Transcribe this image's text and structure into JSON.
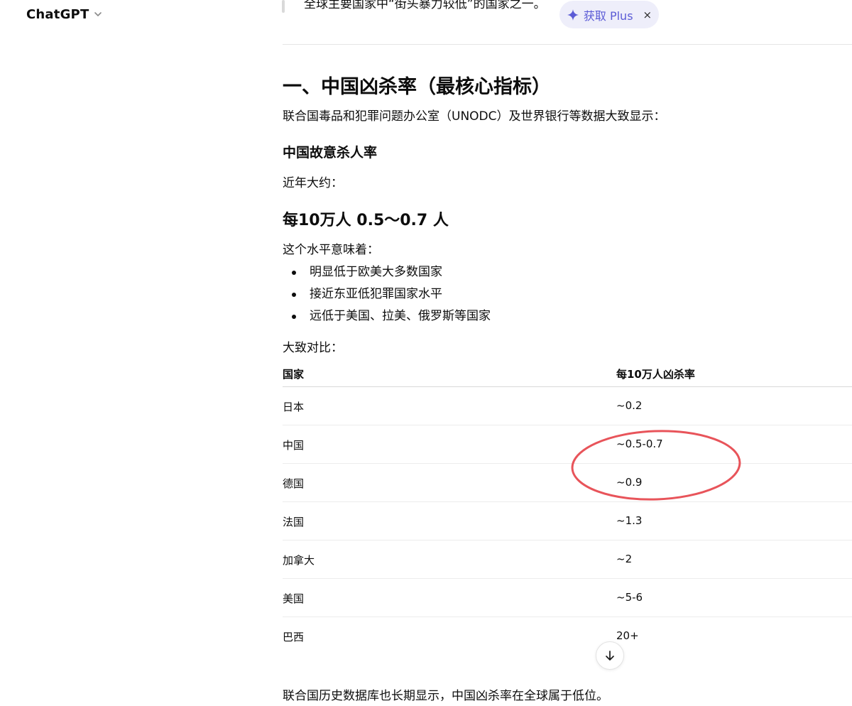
{
  "header": {
    "model_name": "ChatGPT"
  },
  "plus_banner": {
    "label": "获取 Plus",
    "close": "×",
    "accent": "#5b5bd6"
  },
  "top_quote": {
    "text": "全球主要国家中“街头暴力较低”的国家之一。"
  },
  "section": {
    "heading": "一、中国凶杀率（最核心指标）",
    "intro": "联合国毒品和犯罪问题办公室（UNODC）及世界银行等数据大致显示：",
    "subheading": "中国故意杀人率",
    "recent_label": "近年大约：",
    "rate_highlight": "每10万人 0.5～0.7 人",
    "meaning_label": "这个水平意味着：",
    "bullets": [
      "明显低于欧美大多数国家",
      "接近东亚低犯罪国家水平",
      "远低于美国、拉美、俄罗斯等国家"
    ],
    "compare_label": "大致对比："
  },
  "table": {
    "headers": [
      "国家",
      "每10万人凶杀率"
    ],
    "rows": [
      [
        "日本",
        "~0.2"
      ],
      [
        "中国",
        "~0.5-0.7"
      ],
      [
        "德国",
        "~0.9"
      ],
      [
        "法国",
        "~1.3"
      ],
      [
        "加拿大",
        "~2"
      ],
      [
        "美国",
        "~5-6"
      ],
      [
        "巴西",
        "20+"
      ]
    ]
  },
  "closing": "联合国历史数据库也长期显示，中国凶杀率在全球属于低位。",
  "annotation": {
    "color": "#e8545a"
  }
}
